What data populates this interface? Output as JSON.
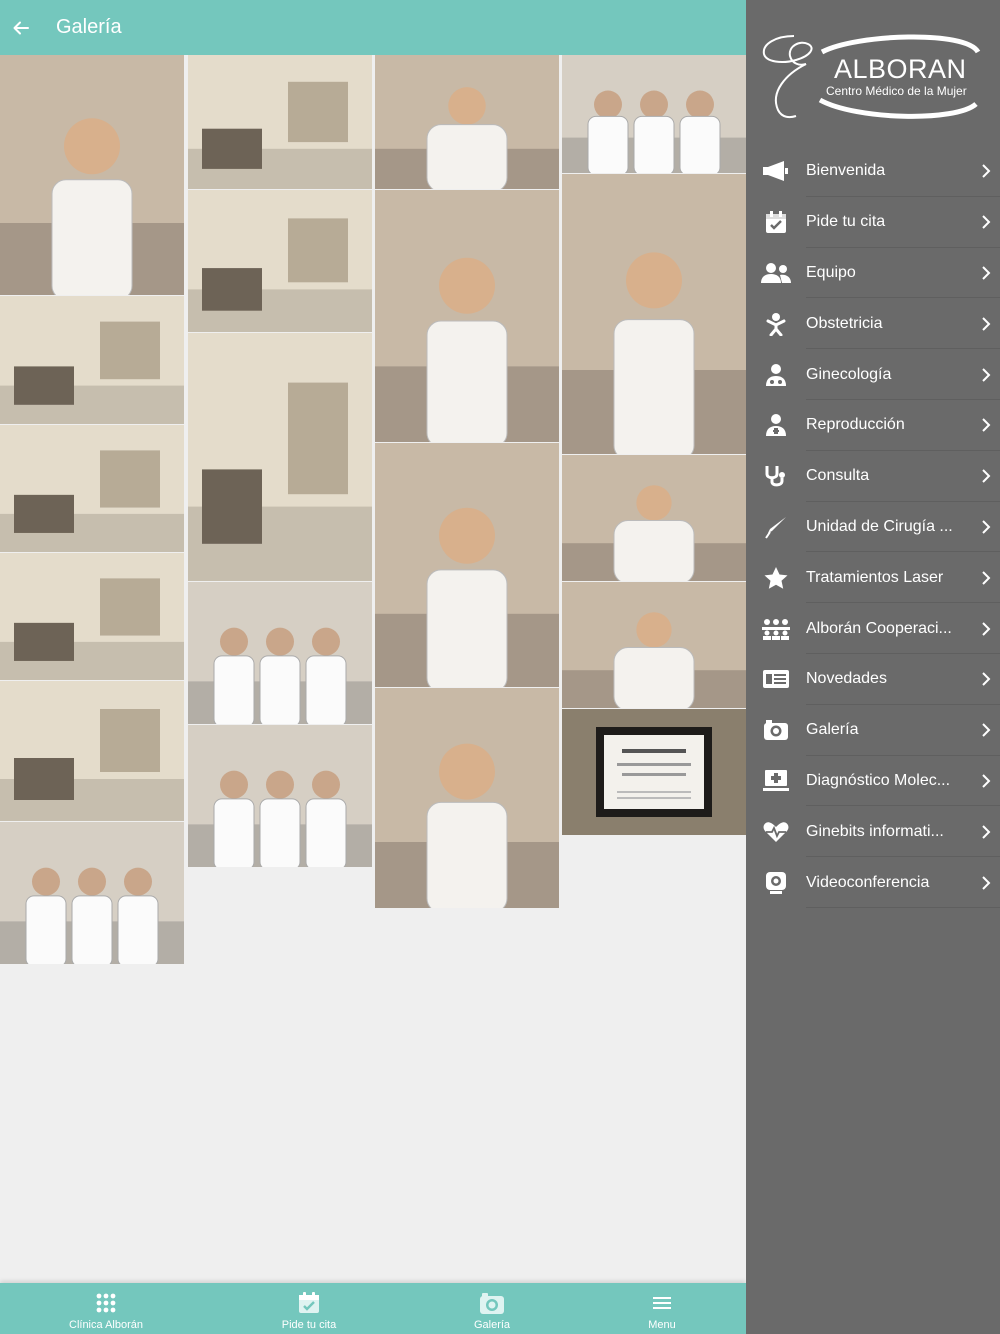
{
  "header": {
    "title": "Galería",
    "back_icon": "arrow-left-icon"
  },
  "brand": {
    "name": "ALBORAN",
    "tagline": "Centro Médico de la Mujer"
  },
  "menu": {
    "items": [
      {
        "label": "Bienvenida",
        "icon": "megaphone-icon"
      },
      {
        "label": "Pide tu cita",
        "icon": "calendar-check-icon"
      },
      {
        "label": "Equipo",
        "icon": "users-icon"
      },
      {
        "label": "Obstetricia",
        "icon": "baby-icon"
      },
      {
        "label": "Ginecología",
        "icon": "female-doctor-icon"
      },
      {
        "label": "Reproducción",
        "icon": "doctor-icon"
      },
      {
        "label": "Consulta",
        "icon": "stethoscope-icon"
      },
      {
        "label": "Unidad de Cirugía ...",
        "icon": "scalpel-icon"
      },
      {
        "label": "Tratamientos Laser",
        "icon": "star-icon"
      },
      {
        "label": "Alborán Cooperaci...",
        "icon": "group-icon"
      },
      {
        "label": "Novedades",
        "icon": "news-icon"
      },
      {
        "label": "Galería",
        "icon": "camera-icon"
      },
      {
        "label": "Diagnóstico Molec...",
        "icon": "medical-monitor-icon"
      },
      {
        "label": "Ginebits informati...",
        "icon": "heartbeat-icon"
      },
      {
        "label": "Videoconferencia",
        "icon": "webcam-icon"
      }
    ]
  },
  "tabs": [
    {
      "label": "Clínica Alborán",
      "icon": "grid-dots-icon"
    },
    {
      "label": "Pide tu cita",
      "icon": "calendar-check-icon"
    },
    {
      "label": "Galería",
      "icon": "camera-icon"
    },
    {
      "label": "Menu",
      "icon": "hamburger-icon"
    }
  ],
  "gallery": {
    "photos": [
      {
        "name": "photo-doctor-desk",
        "kind": "portrait",
        "col": 0
      },
      {
        "name": "photo-office-library",
        "kind": "room",
        "col": 0
      },
      {
        "name": "photo-ultrasound-room",
        "kind": "room",
        "col": 0
      },
      {
        "name": "photo-waiting-room-tv",
        "kind": "room",
        "col": 0
      },
      {
        "name": "photo-waiting-room-banner",
        "kind": "room",
        "col": 0
      },
      {
        "name": "photo-three-staff-masks",
        "kind": "group",
        "col": 0
      },
      {
        "name": "photo-reception-plants",
        "kind": "room",
        "col": 1
      },
      {
        "name": "photo-lobby-banner",
        "kind": "room",
        "col": 1
      },
      {
        "name": "photo-banner-corridor",
        "kind": "room",
        "col": 1
      },
      {
        "name": "photo-staff-group-banner",
        "kind": "group",
        "col": 1
      },
      {
        "name": "photo-staff-group-masks",
        "kind": "group",
        "col": 1
      },
      {
        "name": "photo-doctor-mask-banner",
        "kind": "portrait",
        "col": 2
      },
      {
        "name": "photo-doctor-reading",
        "kind": "portrait",
        "col": 2
      },
      {
        "name": "photo-doctor-book",
        "kind": "portrait",
        "col": 2
      },
      {
        "name": "photo-doctor-arms-crossed",
        "kind": "portrait",
        "col": 2
      },
      {
        "name": "photo-three-nurses",
        "kind": "group",
        "col": 3
      },
      {
        "name": "photo-staff-banner-portrait",
        "kind": "portrait",
        "col": 3
      },
      {
        "name": "photo-reception-desk",
        "kind": "portrait",
        "col": 3
      },
      {
        "name": "photo-computer-desk",
        "kind": "portrait",
        "col": 3
      },
      {
        "name": "photo-topdoctors-certificate",
        "kind": "certificate",
        "col": 3
      }
    ]
  },
  "colors": {
    "teal": "#74c7bd",
    "menu_bg": "#6a6a6a",
    "content_bg": "#efefef"
  }
}
